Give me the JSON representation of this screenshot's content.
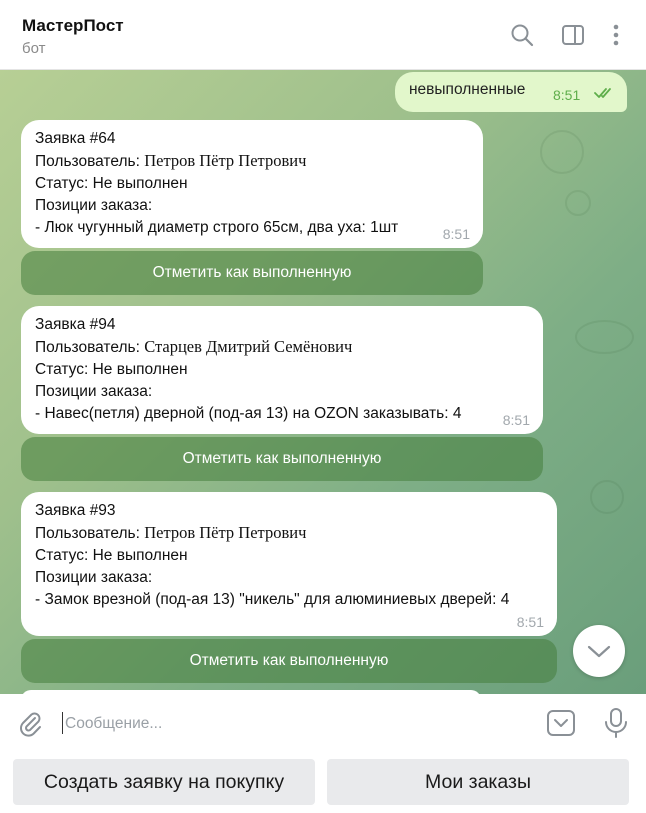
{
  "header": {
    "title": "МастерПост",
    "subtitle": "бот"
  },
  "outgoing": {
    "text": "невыполненные",
    "time": "8:51"
  },
  "orders": [
    {
      "title": "Заявка #64",
      "user_label": "Пользователь: ",
      "user_name": "Петров Пётр Петрович",
      "status": "Статус: Не выполнен",
      "items_label": "Позиции заказа:",
      "item": "- Люк чугунный диаметр строго 65см, два уха: 1шт",
      "time": "8:51",
      "button": "Отметить как выполненную"
    },
    {
      "title": "Заявка #94",
      "user_label": "Пользователь: ",
      "user_name": "Старцев Дмитрий Семёнович",
      "status": "Статус: Не выполнен",
      "items_label": "Позиции заказа:",
      "item": "- Навес(петля) дверной (под-ая 13) на OZON заказывать: 4",
      "time": "8:51",
      "button": "Отметить как выполненную"
    },
    {
      "title": "Заявка #93",
      "user_label": "Пользователь: ",
      "user_name": "Петров Пётр Петрович",
      "status": "Статус: Не выполнен",
      "items_label": "Позиции заказа:",
      "item": "- Замок врезной (под-ая 13) \"никель\" для алюминиевых дверей: 4",
      "time": "8:51",
      "button": "Отметить как выполненную"
    }
  ],
  "composer": {
    "placeholder": "Сообщение..."
  },
  "reply_keyboard": {
    "create_order": "Создать заявку на покупку",
    "my_orders": "Мои заказы"
  },
  "icons": [
    "search-icon",
    "sidebar-toggle-icon",
    "more-vertical-icon",
    "double-check-icon",
    "chevron-down-icon",
    "attach-icon",
    "keyboard-toggle-icon",
    "microphone-icon"
  ]
}
